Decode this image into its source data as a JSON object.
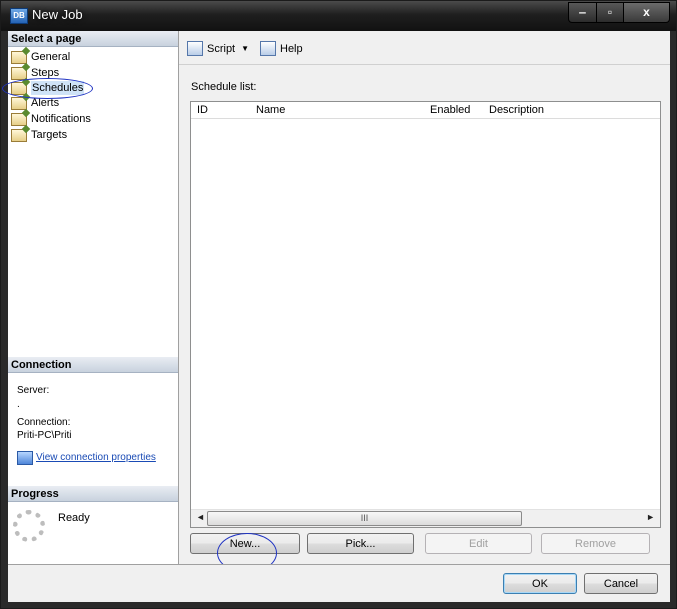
{
  "window": {
    "title": "New Job",
    "app_icon_text": "DB",
    "controls": {
      "minimize": "‒",
      "maximize": "▫",
      "close": "x"
    }
  },
  "left_pane": {
    "select_page_header": "Select a page",
    "pages": [
      {
        "label": "General"
      },
      {
        "label": "Steps"
      },
      {
        "label": "Schedules",
        "selected": true
      },
      {
        "label": "Alerts"
      },
      {
        "label": "Notifications"
      },
      {
        "label": "Targets"
      }
    ],
    "connection_header": "Connection",
    "server_label": "Server:",
    "server_value": ".",
    "connection_label": "Connection:",
    "connection_value": "Priti-PC\\Priti",
    "view_connection_link": "View connection properties",
    "progress_header": "Progress",
    "progress_status": "Ready"
  },
  "toolbar": {
    "script_label": "Script",
    "script_icon": "script-icon",
    "dropdown_icon": "chevron-down-icon",
    "help_label": "Help",
    "help_icon": "help-icon"
  },
  "main": {
    "schedule_list_label": "Schedule list:",
    "columns": [
      "ID",
      "Name",
      "Enabled",
      "Description"
    ],
    "rows": [],
    "scrollbar_grip": "III"
  },
  "buttons": {
    "new": "New...",
    "pick": "Pick...",
    "edit": "Edit",
    "remove": "Remove",
    "ok": "OK",
    "cancel": "Cancel"
  },
  "colors": {
    "annotation_circle": "#1f33c2",
    "link": "#1a4bb5",
    "header_gradient_top": "#e9edf3"
  }
}
